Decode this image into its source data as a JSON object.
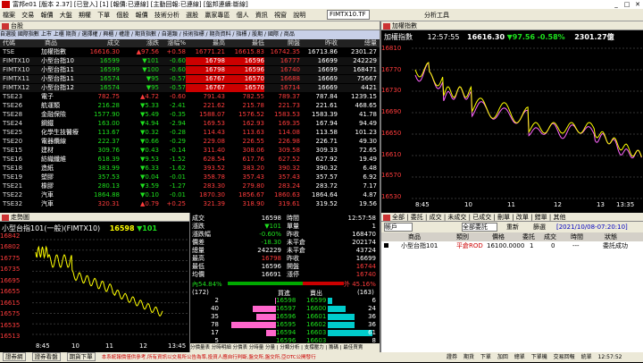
{
  "app": {
    "title": "富邦e01 [版本 2.37] [已登入] [1] [報價:已連線] [主動回報:已連線] [盤邦連續:斷線]",
    "icons": "close-icon"
  },
  "menu": {
    "items": [
      "檔案",
      "交易",
      "報價",
      "大盤",
      "期權",
      "下單",
      "個股",
      "報價",
      "技術分析",
      "選股",
      "贏家專區",
      "個人",
      "資訊",
      "視窗",
      "說明"
    ],
    "symbol": "FIMTX10.TF",
    "extra": "分析工具"
  },
  "quote": {
    "title": "台股",
    "tabs": "自選股 國際指數 上市 上櫃 期貨 / 選擇權 / 興櫃 / 權證 / 期貨指數 / 自選類 / 技術指標 / 期貨資料 / 指標 / 股期 / 國際 / 商品",
    "headers": [
      "代碼",
      "商品",
      "成交",
      "漲跌",
      "漲幅%",
      "最高",
      "最低",
      "開盤",
      "昨收",
      "總量"
    ],
    "rows": [
      [
        "TSE",
        "加權指數",
        "16616.30",
        "▲97.56",
        "+0.58",
        "16771.21",
        "16615.83",
        "16742.35",
        "16713.86",
        "2301.27"
      ],
      [
        "FIMTX10",
        "小型台指10",
        "16599",
        "▼101",
        "-0.60",
        "16798",
        "16596",
        "16777",
        "16699",
        "242229"
      ],
      [
        "FIMTX10",
        "小型台指11",
        "16599",
        "▼100",
        "-0.60",
        "16798",
        "16596",
        "16740",
        "16699",
        "168471"
      ],
      [
        "FIMTX11",
        "小型台指11",
        "16574",
        "▼95",
        "-0.57",
        "16767",
        "16570",
        "16688",
        "16669",
        "75667"
      ],
      [
        "FIMTX12",
        "小型台指12",
        "16574",
        "▼95",
        "-0.57",
        "16767",
        "16570",
        "16714",
        "16669",
        "4421"
      ],
      [
        "TSE23",
        "電子",
        "782.75",
        "▲4.72",
        "-0.60",
        "791.43",
        "782.55",
        "789.37",
        "787.84",
        "1239.15"
      ],
      [
        "TSE26",
        "航運類",
        "216.28",
        "▼5.33",
        "-2.41",
        "221.62",
        "215.78",
        "221.73",
        "221.61",
        "468.65"
      ],
      [
        "TSE28",
        "金融保險",
        "1577.90",
        "▼5.49",
        "-0.35",
        "1588.07",
        "1576.52",
        "1583.53",
        "1583.39",
        "41.78"
      ],
      [
        "TSE24",
        "鋼鐵",
        "163.00",
        "▼4.94",
        "-2.94",
        "169.53",
        "162.93",
        "169.35",
        "167.94",
        "94.49"
      ],
      [
        "TSE25",
        "化學生技醫療",
        "113.67",
        "▼0.32",
        "-0.28",
        "114.43",
        "113.63",
        "114.08",
        "113.58",
        "101.23"
      ],
      [
        "TSE20",
        "電器纜線",
        "222.37",
        "▼0.66",
        "-0.29",
        "229.08",
        "226.55",
        "226.98",
        "226.71",
        "49.30"
      ],
      [
        "TSE15",
        "建材",
        "309.76",
        "▼0.43",
        "-0.14",
        "311.40",
        "308.06",
        "309.58",
        "309.33",
        "72.65"
      ],
      [
        "TSE16",
        "紡織纖維",
        "618.39",
        "▼9.53",
        "-1.52",
        "628.54",
        "617.76",
        "627.52",
        "627.92",
        "19.49"
      ],
      [
        "TSE18",
        "造紙",
        "383.99",
        "▼6.33",
        "-1.62",
        "393.52",
        "383.20",
        "390.32",
        "390.32",
        "6.48"
      ],
      [
        "TSE19",
        "塑膠",
        "357.53",
        "▼0.04",
        "-0.01",
        "358.78",
        "357.43",
        "357.43",
        "357.57",
        "6.92"
      ],
      [
        "TSE21",
        "橡膠",
        "280.13",
        "▼3.59",
        "-1.27",
        "283.30",
        "279.80",
        "283.24",
        "283.72",
        "7.17"
      ],
      [
        "TSE22",
        "汽車",
        "1864.88",
        "▼0.10",
        "-0.01",
        "1870.30",
        "1856.67",
        "1860.63",
        "1864.64",
        "4.87"
      ],
      [
        "TSE32",
        "汽車",
        "320.31",
        "▲0.79",
        "+0.25",
        "321.39",
        "318.90",
        "319.61",
        "319.52",
        "19.56"
      ]
    ]
  },
  "chart_tl": {
    "title": "加權指數",
    "time": "12:57:55",
    "price": "16616.30",
    "change": "▼97.56",
    "pct": "-0.58%",
    "vol": "2301.27億",
    "yticks": [
      "16810",
      "16770",
      "16730",
      "16690",
      "16650",
      "16610",
      "16570",
      "16530"
    ],
    "xticks": [
      "8:45",
      "10",
      "11",
      "12",
      "13",
      "13:35"
    ]
  },
  "chart_fut": {
    "title": "小型台指101(一般)(FIMTX10)",
    "price": "16598",
    "change": "▼101",
    "yticks": [
      "16842",
      "16802",
      "16775",
      "16735",
      "16695",
      "16655",
      "16615",
      "16575",
      "16535",
      "16513"
    ],
    "xticks": [
      "8:45",
      "10",
      "11",
      "12",
      "13:45"
    ]
  },
  "detail": {
    "title": "小型台指101(一般)",
    "time": "12:57:58",
    "left": [
      [
        "成交",
        "16598"
      ],
      [
        "漲跌",
        "▼101"
      ],
      [
        "漲跌幅",
        "-0.60%"
      ],
      [
        "價差",
        "-18.30"
      ],
      [
        "總量",
        "242229"
      ],
      [
        "最高",
        "16798"
      ],
      [
        "最低",
        "16596"
      ],
      [
        "均價",
        "16691"
      ]
    ],
    "right": [
      [
        "時間",
        "12:57:58"
      ],
      [
        "單量",
        "1"
      ],
      [
        "昨收",
        "168470"
      ],
      [
        "未平倉",
        "202174"
      ],
      [
        "未平倉",
        "43724"
      ],
      [
        "昨收",
        "16699"
      ],
      [
        "開盤",
        "16744"
      ],
      [
        "漲停",
        "16740"
      ]
    ],
    "ratio_l": "內54.84%",
    "ratio_r": "外 45.16%",
    "count_l": "(172)",
    "count_r": "(163)",
    "bid_hdr": "買進",
    "ask_hdr": "賣出",
    "book": [
      [
        "2",
        "16598",
        "16599",
        "6"
      ],
      [
        "40",
        "16597",
        "16600",
        "24"
      ],
      [
        "35",
        "16596",
        "16601",
        "36"
      ],
      [
        "78",
        "16595",
        "16602",
        "36"
      ],
      [
        "17",
        "16594",
        "16603",
        "61"
      ]
    ],
    "tot": [
      "5",
      "16596",
      "16603",
      "8"
    ],
    "tabs": "分價量表 分時明細 分價表 分時量 分量 | 分類分析 | 支撐壓力 | 籌碼 | 最佳買賣"
  },
  "order": {
    "title": "委託",
    "account": "帳戶",
    "filter": "全部委託",
    "refresh": "重新",
    "status_link": "篩選",
    "date": "[2021/10/08-07:20:10]",
    "headers": [
      "商品",
      "類別",
      "價格",
      "委託",
      "成交",
      "時間",
      "狀態"
    ],
    "row": [
      "小型台指101",
      "平倉ROD",
      "16100.0000",
      "1",
      "0",
      "---",
      "委託成功"
    ],
    "tabs": "全部 | 委託 | 成交 | 未成交 | 已成交 | 刪單 | 改單 | 錯單 | 其他"
  },
  "status": {
    "items": [
      "證券網",
      "證券看盤",
      "期貨下單",
      "本系統報價僅供參考,所有資訊以交易所公告為準,投資人應自行判斷,盤交所,盤交所,亞OTC公開發行"
    ],
    "right": [
      "證券",
      "期貨",
      "下單",
      "加回",
      "總單",
      "下單機",
      "交易回報",
      "統單",
      "12:57:52"
    ]
  }
}
